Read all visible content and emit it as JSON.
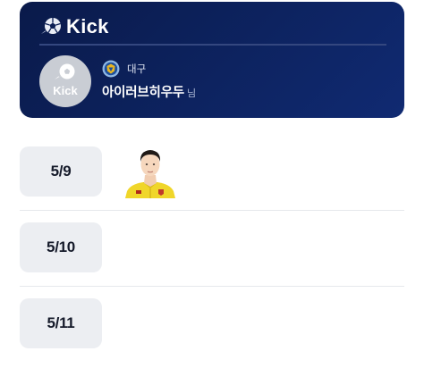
{
  "header": {
    "brand": "Kick",
    "brand_icon": "soccer-ball-icon",
    "bg_color": "#0c1f55"
  },
  "profile": {
    "avatar_label": "Kick",
    "avatar_icon": "soccer-ball-icon",
    "team_emblem": "daegu-fc-emblem",
    "team": "대구",
    "username": "아이러브히우두",
    "suffix": "님"
  },
  "schedule": [
    {
      "date": "5/9",
      "players": [
        "player-photo"
      ]
    },
    {
      "date": "5/10",
      "players": []
    },
    {
      "date": "5/11",
      "players": []
    }
  ]
}
